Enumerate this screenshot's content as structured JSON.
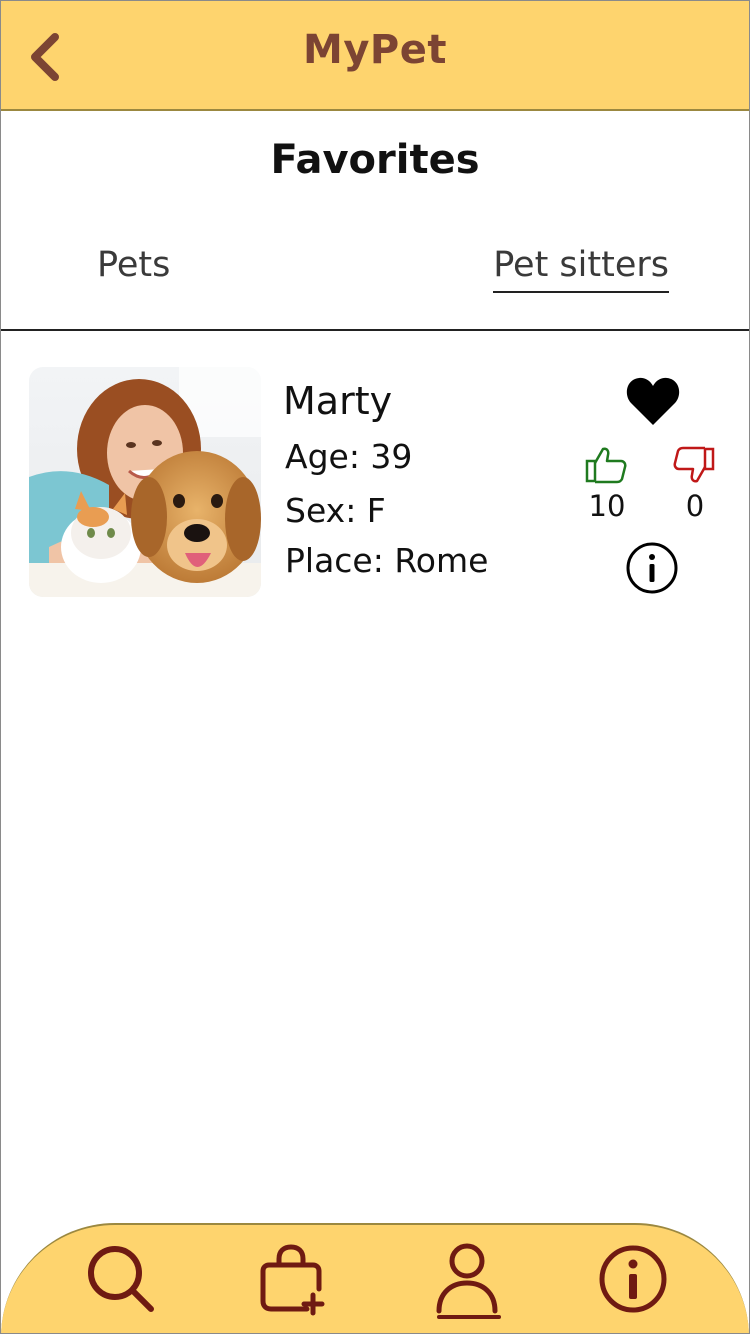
{
  "header": {
    "app_title": "MyPet",
    "back_icon": "chevron-left-icon"
  },
  "page": {
    "title": "Favorites"
  },
  "tabs": [
    {
      "label": "Pets",
      "active": false
    },
    {
      "label": "Pet sitters",
      "active": true
    }
  ],
  "favorites": [
    {
      "name": "Marty",
      "age": "Age: 39",
      "sex": "Sex: F",
      "place": "Place: Rome",
      "likes": "10",
      "dislikes": "0",
      "favorited": true
    }
  ],
  "bottom_nav": {
    "items": [
      {
        "icon": "search-icon",
        "active": false
      },
      {
        "icon": "bag-add-icon",
        "active": false
      },
      {
        "icon": "profile-icon",
        "active": true
      },
      {
        "icon": "info-icon",
        "active": false
      }
    ]
  },
  "colors": {
    "bar_bg": "#fed46e",
    "title_brown": "#7c4433",
    "nav_icon": "#6f1a12",
    "like_green": "#1f7a1f",
    "dislike_red": "#c01818"
  }
}
